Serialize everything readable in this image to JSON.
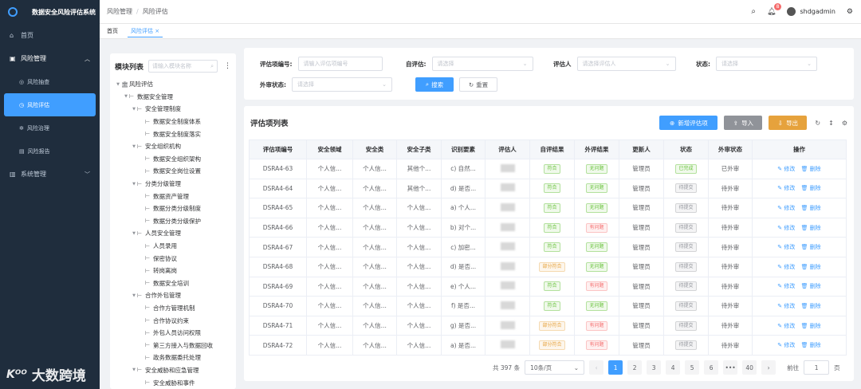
{
  "app": {
    "title": "数据安全风险评估系统"
  },
  "sidebar": {
    "home": "首页",
    "risk_mgmt": "风险管理",
    "sub": [
      "风险抽查",
      "风险评估",
      "风险治理",
      "风险报告"
    ],
    "sys_mgmt": "系统管理"
  },
  "header": {
    "breadcrumb": [
      "风险管理",
      "风险评估"
    ],
    "badge": "8",
    "user": "shdgadmin"
  },
  "tags": {
    "home": "首页",
    "current": "风险评估 ×"
  },
  "tree": {
    "title": "模块列表",
    "search_placeholder": "请输入模块名称",
    "nodes": [
      {
        "d": 0,
        "open": true,
        "label": "风险评估"
      },
      {
        "d": 1,
        "open": true,
        "label": "数据安全管理"
      },
      {
        "d": 2,
        "open": true,
        "label": "安全管理制度"
      },
      {
        "d": 3,
        "label": "数据安全制度体系"
      },
      {
        "d": 3,
        "label": "数据安全制度落实"
      },
      {
        "d": 2,
        "open": true,
        "label": "安全组织机构"
      },
      {
        "d": 3,
        "label": "数据安全组织架构"
      },
      {
        "d": 3,
        "label": "数据安全岗位设置"
      },
      {
        "d": 2,
        "open": true,
        "label": "分类分级管理"
      },
      {
        "d": 3,
        "label": "数据资产管理"
      },
      {
        "d": 3,
        "label": "数据分类分级制度"
      },
      {
        "d": 3,
        "label": "数据分类分级保护"
      },
      {
        "d": 2,
        "open": true,
        "label": "人员安全管理"
      },
      {
        "d": 3,
        "label": "人员录用"
      },
      {
        "d": 3,
        "label": "保密协议"
      },
      {
        "d": 3,
        "label": "转岗离岗"
      },
      {
        "d": 3,
        "label": "数据安全培训"
      },
      {
        "d": 2,
        "open": true,
        "label": "合作外包管理"
      },
      {
        "d": 3,
        "label": "合作方管理机制"
      },
      {
        "d": 3,
        "label": "合作协议约束"
      },
      {
        "d": 3,
        "label": "外包人员访问权限"
      },
      {
        "d": 3,
        "label": "第三方接入与数据回收"
      },
      {
        "d": 3,
        "label": "政务数据委托处理"
      },
      {
        "d": 2,
        "open": true,
        "label": "安全威胁和应急管理"
      },
      {
        "d": 3,
        "label": "安全威胁和事件"
      }
    ]
  },
  "filter": {
    "code_label": "评估项编号:",
    "code_ph": "请输入评估项编号",
    "self_label": "自评估:",
    "self_ph": "请选择",
    "assessor_label": "评估人",
    "assessor_ph": "请选择评估人",
    "status_label": "状态:",
    "status_ph": "请选择",
    "ext_label": "外审状态:",
    "ext_ph": "请选择",
    "search": "搜索",
    "reset": "重置"
  },
  "list": {
    "title": "评估项列表",
    "add": "新增评估项",
    "import": "导入",
    "export": "导出",
    "columns": [
      "评估项编号",
      "安全领域",
      "安全类",
      "安全子类",
      "识别要素",
      "评估人",
      "自评结果",
      "外评结果",
      "更新人",
      "状态",
      "外审状态",
      "操作"
    ],
    "edit": "修改",
    "del": "删除",
    "rows": [
      {
        "id": "DSRA4-63",
        "a": "个人信...",
        "b": "个人信...",
        "c": "其他个...",
        "d": "c) 自然...",
        "self": "符合",
        "selfc": "g",
        "ext": "无问题",
        "extc": "g",
        "upd": "管理员",
        "st": "已完成",
        "stc": "g",
        "ext_st": "已外审"
      },
      {
        "id": "DSRA4-64",
        "a": "个人信...",
        "b": "个人信...",
        "c": "其他个...",
        "d": "d) 是否...",
        "self": "符合",
        "selfc": "g",
        "ext": "无问题",
        "extc": "g",
        "upd": "管理员",
        "st": "待提交",
        "stc": "gray",
        "ext_st": "待外审"
      },
      {
        "id": "DSRA4-65",
        "a": "个人信...",
        "b": "个人信...",
        "c": "个人信...",
        "d": "a) 个人...",
        "self": "符合",
        "selfc": "g",
        "ext": "无问题",
        "extc": "g",
        "upd": "管理员",
        "st": "待提交",
        "stc": "gray",
        "ext_st": "待外审"
      },
      {
        "id": "DSRA4-66",
        "a": "个人信...",
        "b": "个人信...",
        "c": "个人信...",
        "d": "b) 对个...",
        "self": "符合",
        "selfc": "g",
        "ext": "有问题",
        "extc": "r",
        "upd": "管理员",
        "st": "待提交",
        "stc": "gray",
        "ext_st": "待外审"
      },
      {
        "id": "DSRA4-67",
        "a": "个人信...",
        "b": "个人信...",
        "c": "个人信...",
        "d": "c) 加密...",
        "self": "符合",
        "selfc": "g",
        "ext": "无问题",
        "extc": "g",
        "upd": "管理员",
        "st": "待提交",
        "stc": "gray",
        "ext_st": "待外审"
      },
      {
        "id": "DSRA4-68",
        "a": "个人信...",
        "b": "个人信...",
        "c": "个人信...",
        "d": "d) 是否...",
        "self": "部分符合",
        "selfc": "o",
        "ext": "无问题",
        "extc": "g",
        "upd": "管理员",
        "st": "待提交",
        "stc": "gray",
        "ext_st": "待外审"
      },
      {
        "id": "DSRA4-69",
        "a": "个人信...",
        "b": "个人信...",
        "c": "个人信...",
        "d": "e) 个人...",
        "self": "符合",
        "selfc": "g",
        "ext": "有问题",
        "extc": "r",
        "upd": "管理员",
        "st": "待提交",
        "stc": "gray",
        "ext_st": "待外审"
      },
      {
        "id": "DSRA4-70",
        "a": "个人信...",
        "b": "个人信...",
        "c": "个人信...",
        "d": "f) 是否...",
        "self": "符合",
        "selfc": "g",
        "ext": "无问题",
        "extc": "g",
        "upd": "管理员",
        "st": "待提交",
        "stc": "gray",
        "ext_st": "待外审"
      },
      {
        "id": "DSRA4-71",
        "a": "个人信...",
        "b": "个人信...",
        "c": "个人信...",
        "d": "g) 是否...",
        "self": "部分符合",
        "selfc": "o",
        "ext": "有问题",
        "extc": "r",
        "upd": "管理员",
        "st": "待提交",
        "stc": "gray",
        "ext_st": "待外审"
      },
      {
        "id": "DSRA4-72",
        "a": "个人信...",
        "b": "个人信...",
        "c": "个人信...",
        "d": "a) 是否...",
        "self": "部分符合",
        "selfc": "o",
        "ext": "有问题",
        "extc": "r",
        "upd": "管理员",
        "st": "待提交",
        "stc": "gray",
        "ext_st": "待外审"
      }
    ]
  },
  "pager": {
    "total": "共 397 条",
    "size": "10条/页",
    "pages": [
      "1",
      "2",
      "3",
      "4",
      "5",
      "6",
      "•••",
      "40"
    ],
    "goto": "前往",
    "goto_val": "1",
    "page_unit": "页"
  },
  "watermark": {
    "text": "大数跨境"
  }
}
